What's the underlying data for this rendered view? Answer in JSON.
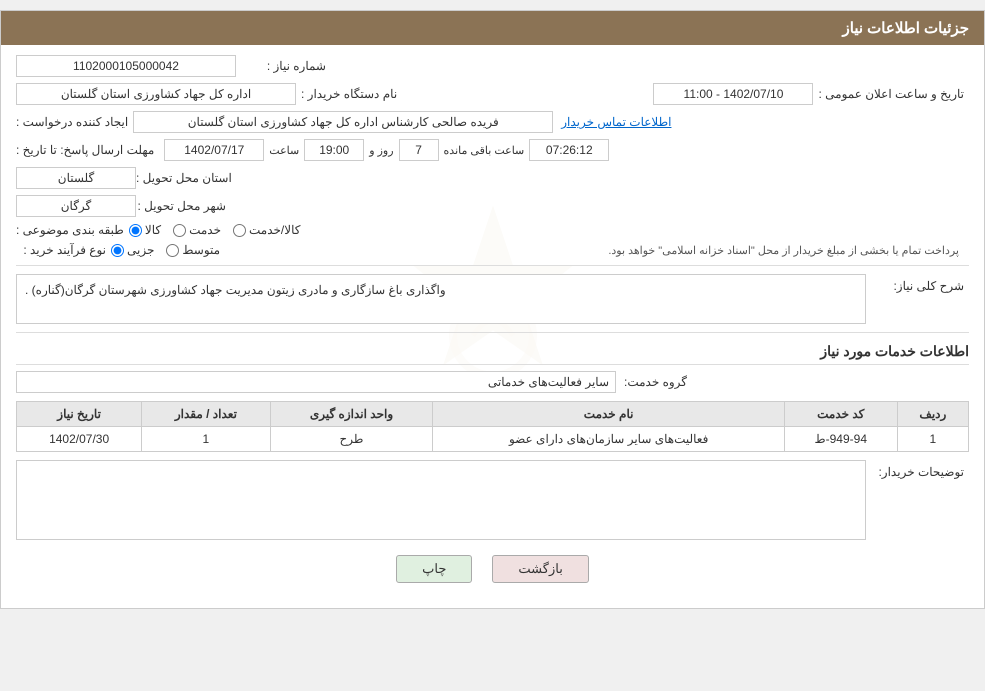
{
  "header": {
    "title": "جزئیات اطلاعات نیاز"
  },
  "fields": {
    "needNumber_label": "شماره نیاز :",
    "needNumber_value": "1102000105000042",
    "orgName_label": "نام دستگاه خریدار :",
    "orgName_value": "اداره کل جهاد کشاورزی استان گلستان",
    "creator_label": "ایجاد کننده درخواست :",
    "creator_value": "فریده صالحی کارشناس اداره کل جهاد کشاورزی استان گلستان",
    "contactInfo_link": "اطلاعات تماس خریدار",
    "announceDate_label": "تاریخ و ساعت اعلان عمومی :",
    "announceDate_value": "1402/07/10 - 11:00",
    "replyDeadline_label": "مهلت ارسال پاسخ: تا تاریخ :",
    "replyDate_value": "1402/07/17",
    "replyTime_value": "19:00",
    "replyDays_value": "7",
    "replyRemaining_value": "07:26:12",
    "replyDaysLabel": "روز و",
    "replyRemainingLabel": "ساعت باقی مانده",
    "province_label": "استان محل تحویل :",
    "province_value": "گلستان",
    "city_label": "شهر محل تحویل :",
    "city_value": "گرگان",
    "category_label": "طبقه بندی موضوعی :",
    "category_options": [
      "کالا",
      "خدمت",
      "کالا/خدمت"
    ],
    "category_selected": "کالا",
    "purchaseType_label": "نوع فرآیند خرید :",
    "purchaseType_options": [
      "جزیی",
      "متوسط"
    ],
    "purchaseType_selected": "جزیی",
    "purchaseType_note": "پرداخت تمام یا بخشی از مبلغ خریدار از محل \"اسناد خزانه اسلامی\" خواهد بود.",
    "needDesc_label": "شرح کلی نیاز:",
    "needDesc_value": "واگذاری باغ سازگاری و مادری زیتون مدیریت جهاد کشاورزی شهرستان گرگان(گناره) .",
    "serviceInfo_title": "اطلاعات خدمات مورد نیاز",
    "serviceGroup_label": "گروه خدمت:",
    "serviceGroup_value": "سایر فعالیت‌های خدماتی",
    "table": {
      "headers": [
        "ردیف",
        "کد خدمت",
        "نام خدمت",
        "واحد اندازه گیری",
        "تعداد / مقدار",
        "تاریخ نیاز"
      ],
      "rows": [
        {
          "row": "1",
          "code": "949-94-ط",
          "name": "فعالیت‌های سایر سازمان‌های دارای عضو",
          "unit": "طرح",
          "count": "1",
          "date": "1402/07/30"
        }
      ]
    },
    "buyerNotes_label": "توضیحات خریدار:",
    "buyerNotes_value": ""
  },
  "buttons": {
    "print_label": "چاپ",
    "back_label": "بازگشت"
  }
}
